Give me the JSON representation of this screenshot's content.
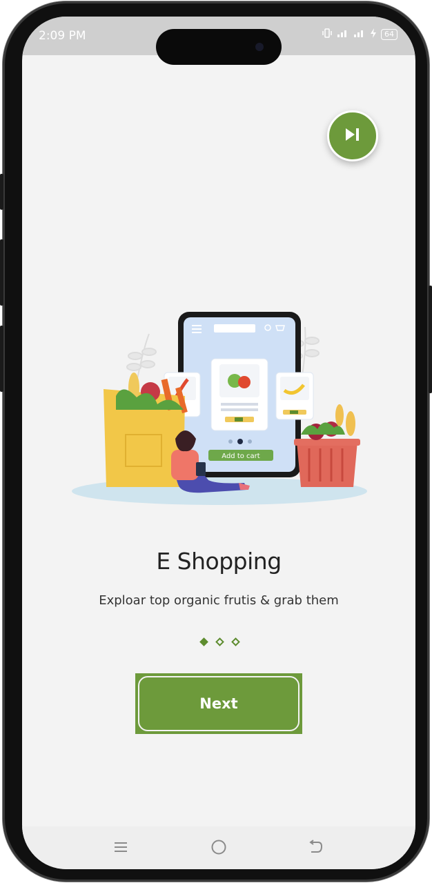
{
  "status_bar": {
    "time": "2:09 PM",
    "icons": [
      "vibrate-icon",
      "signal-icon",
      "signal-icon",
      "charging-icon"
    ],
    "battery": "64"
  },
  "skip_button": {
    "icon": "skip-next-icon"
  },
  "illustration": {
    "add_to_cart_label": "Add to cart",
    "description_icons": [
      "menu-icon",
      "search-icon",
      "cart-icon"
    ]
  },
  "onboarding": {
    "title": "E Shopping",
    "subtitle": "Exploar top organic frutis & grab them",
    "pages": 3,
    "current_page": 1
  },
  "next_button": {
    "label": "Next"
  },
  "nav_bar": {
    "icons": [
      "recent-apps-icon",
      "home-icon",
      "back-icon"
    ]
  },
  "colors": {
    "accent": "#6d9a3b",
    "background": "#f3f3f3"
  }
}
